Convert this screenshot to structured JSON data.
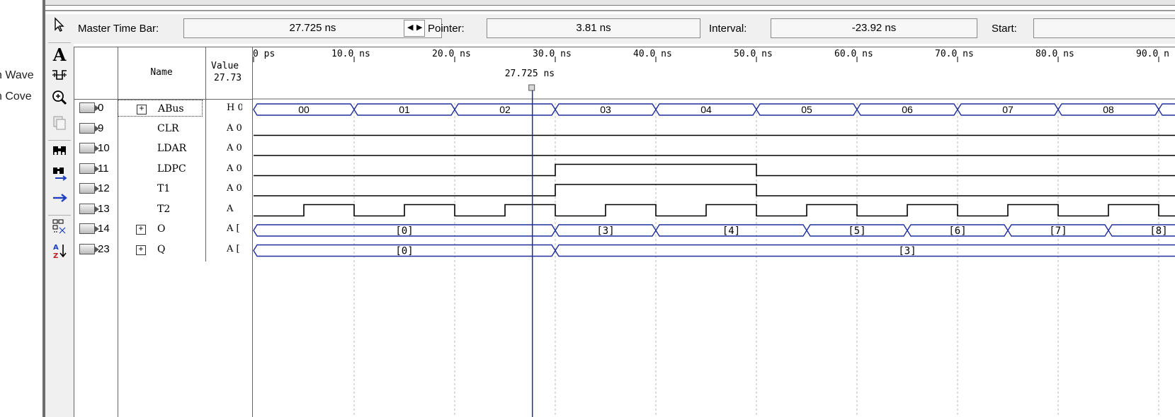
{
  "left_panel": {
    "items": [
      "n Wave",
      "n Cove"
    ]
  },
  "time_bar": {
    "master_label": "Master Time Bar:",
    "master_value": "27.725 ns",
    "pointer_label": "Pointer:",
    "pointer_value": "3.81 ns",
    "interval_label": "Interval:",
    "interval_value": "-23.92 ns",
    "start_label": "Start:",
    "start_value": ""
  },
  "toolbar": {
    "icons": [
      "select-pointer-icon",
      "text-tool-icon",
      "waveform-editing-icon",
      "zoom-icon",
      "full-screen-icon",
      "find-icon",
      "replace-icon",
      "next-transition-icon",
      "group-icon",
      "sort-icon"
    ]
  },
  "grid": {
    "name_header": "Name",
    "value_header": "Value",
    "value_at_cursor": "27.73",
    "cursor_label": "27.725 ns",
    "cursor_time_ns": 27.725,
    "time_ticks": [
      "0 ps",
      "10.0 ns",
      "20.0 ns",
      "30.0 ns",
      "40.0 ns",
      "50.0 ns",
      "60.0 ns",
      "70.0 ns",
      "80.0 ns",
      "90.0 n"
    ]
  },
  "signals": [
    {
      "id": "0",
      "name": "ABus",
      "value": "H 0",
      "expandable": true,
      "type": "bus",
      "segments": [
        {
          "start": 0,
          "end": 10,
          "label": "00"
        },
        {
          "start": 10,
          "end": 20,
          "label": "01"
        },
        {
          "start": 20,
          "end": 30,
          "label": "02"
        },
        {
          "start": 30,
          "end": 40,
          "label": "03"
        },
        {
          "start": 40,
          "end": 50,
          "label": "04"
        },
        {
          "start": 50,
          "end": 60,
          "label": "05"
        },
        {
          "start": 60,
          "end": 70,
          "label": "06"
        },
        {
          "start": 70,
          "end": 80,
          "label": "07"
        },
        {
          "start": 80,
          "end": 90,
          "label": "08"
        }
      ]
    },
    {
      "id": "9",
      "name": "CLR",
      "value": "A 0",
      "expandable": false,
      "type": "bit",
      "levels": [
        {
          "start": 0,
          "end": 100,
          "v": 0
        }
      ]
    },
    {
      "id": "10",
      "name": "LDAR",
      "value": "A 0",
      "expandable": false,
      "type": "bit",
      "levels": [
        {
          "start": 0,
          "end": 100,
          "v": 0
        }
      ]
    },
    {
      "id": "11",
      "name": "LDPC",
      "value": "A 0",
      "expandable": false,
      "type": "bit",
      "levels": [
        {
          "start": 0,
          "end": 30,
          "v": 0
        },
        {
          "start": 30,
          "end": 50,
          "v": 1
        },
        {
          "start": 50,
          "end": 100,
          "v": 0
        }
      ]
    },
    {
      "id": "12",
      "name": "T1",
      "value": "A 0",
      "expandable": false,
      "type": "bit",
      "levels": [
        {
          "start": 0,
          "end": 30,
          "v": 0
        },
        {
          "start": 30,
          "end": 50,
          "v": 1
        },
        {
          "start": 50,
          "end": 100,
          "v": 0
        }
      ]
    },
    {
      "id": "13",
      "name": "T2",
      "value": "A",
      "expandable": false,
      "type": "bit",
      "levels": [
        {
          "start": 0,
          "end": 5,
          "v": 0
        },
        {
          "start": 5,
          "end": 10,
          "v": 1
        },
        {
          "start": 10,
          "end": 15,
          "v": 0
        },
        {
          "start": 15,
          "end": 20,
          "v": 1
        },
        {
          "start": 20,
          "end": 25,
          "v": 0
        },
        {
          "start": 25,
          "end": 30,
          "v": 1
        },
        {
          "start": 30,
          "end": 35,
          "v": 0
        },
        {
          "start": 35,
          "end": 40,
          "v": 1
        },
        {
          "start": 40,
          "end": 45,
          "v": 0
        },
        {
          "start": 45,
          "end": 50,
          "v": 1
        },
        {
          "start": 50,
          "end": 55,
          "v": 0
        },
        {
          "start": 55,
          "end": 60,
          "v": 1
        },
        {
          "start": 60,
          "end": 65,
          "v": 0
        },
        {
          "start": 65,
          "end": 70,
          "v": 1
        },
        {
          "start": 70,
          "end": 75,
          "v": 0
        },
        {
          "start": 75,
          "end": 80,
          "v": 1
        },
        {
          "start": 80,
          "end": 85,
          "v": 0
        },
        {
          "start": 85,
          "end": 90,
          "v": 1
        },
        {
          "start": 90,
          "end": 100,
          "v": 0
        }
      ]
    },
    {
      "id": "14",
      "name": "O",
      "value": "A [",
      "expandable": true,
      "type": "bus",
      "segments": [
        {
          "start": 0,
          "end": 30,
          "label": "[0]"
        },
        {
          "start": 30,
          "end": 40,
          "label": "[3]"
        },
        {
          "start": 40,
          "end": 55,
          "label": "[4]"
        },
        {
          "start": 55,
          "end": 65,
          "label": "[5]"
        },
        {
          "start": 65,
          "end": 75,
          "label": "[6]"
        },
        {
          "start": 75,
          "end": 85,
          "label": "[7]"
        },
        {
          "start": 85,
          "end": 95,
          "label": "[8]"
        }
      ]
    },
    {
      "id": "23",
      "name": "Q",
      "value": "A [",
      "expandable": true,
      "type": "bus",
      "segments": [
        {
          "start": 0,
          "end": 30,
          "label": "[0]"
        },
        {
          "start": 30,
          "end": 100,
          "label": "[3]"
        }
      ]
    }
  ],
  "colors": {
    "bus_line": "#1f2f9e",
    "cursor": "#1f2f9e",
    "wave_black": "#000000",
    "grid_dash": "#b8b8b8"
  }
}
